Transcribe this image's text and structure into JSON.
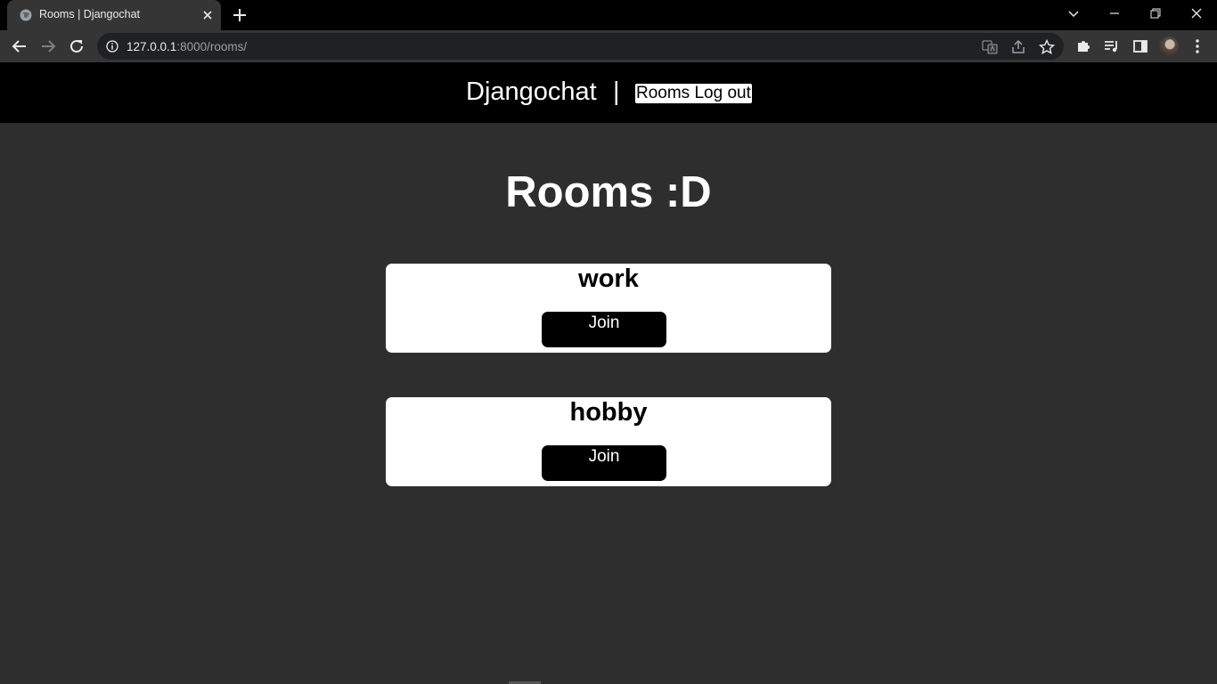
{
  "browser": {
    "tab_title": "Rooms | Djangochat",
    "url_host": "127.0.0.1",
    "url_rest": ":8000/rooms/"
  },
  "header": {
    "brand": "Djangochat",
    "separator": "|",
    "nav": {
      "rooms_label": "Rooms",
      "logout_label": "Log out"
    }
  },
  "main": {
    "title": "Rooms :D",
    "rooms": [
      {
        "name": "work",
        "button_label": "Join"
      },
      {
        "name": "hobby",
        "button_label": "Join"
      }
    ]
  },
  "colors": {
    "page_bg": "#2e2e2e",
    "header_bg": "#000000",
    "card_bg": "#ffffff",
    "button_bg": "#000000"
  }
}
